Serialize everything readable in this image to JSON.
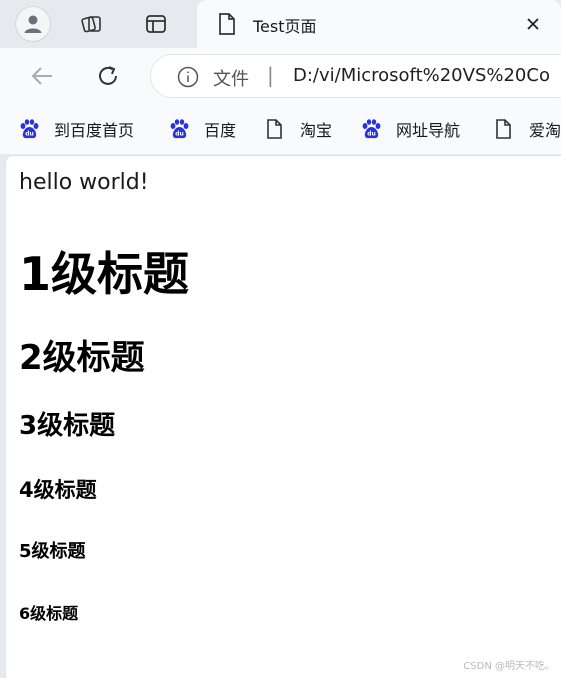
{
  "browser": {
    "tab": {
      "title": "Test页面"
    },
    "address": {
      "site_label": "文件",
      "separator": "|",
      "url": "D:/vi/Microsoft%20VS%20Co"
    },
    "bookmarks": [
      {
        "label": "到百度首页",
        "icon": "baidu-paw-icon"
      },
      {
        "label": "百度",
        "icon": "baidu-paw-icon"
      },
      {
        "label": "淘宝",
        "icon": "file-icon"
      },
      {
        "label": "网址导航",
        "icon": "baidu-paw-icon"
      },
      {
        "label": "爱淘",
        "icon": "file-icon"
      }
    ]
  },
  "page": {
    "paragraph": "hello world!",
    "headings": {
      "h1": "1级标题",
      "h2": "2级标题",
      "h3": "3级标题",
      "h4": "4级标题",
      "h5": "5级标题",
      "h6": "6级标题"
    }
  },
  "watermark": "CSDN @明天不吃。",
  "colors": {
    "chrome_bg": "#e6e9ee",
    "toolbar_bg": "#f9fafb",
    "page_bg": "#ffffff",
    "baidu_blue": "#2932e1"
  }
}
